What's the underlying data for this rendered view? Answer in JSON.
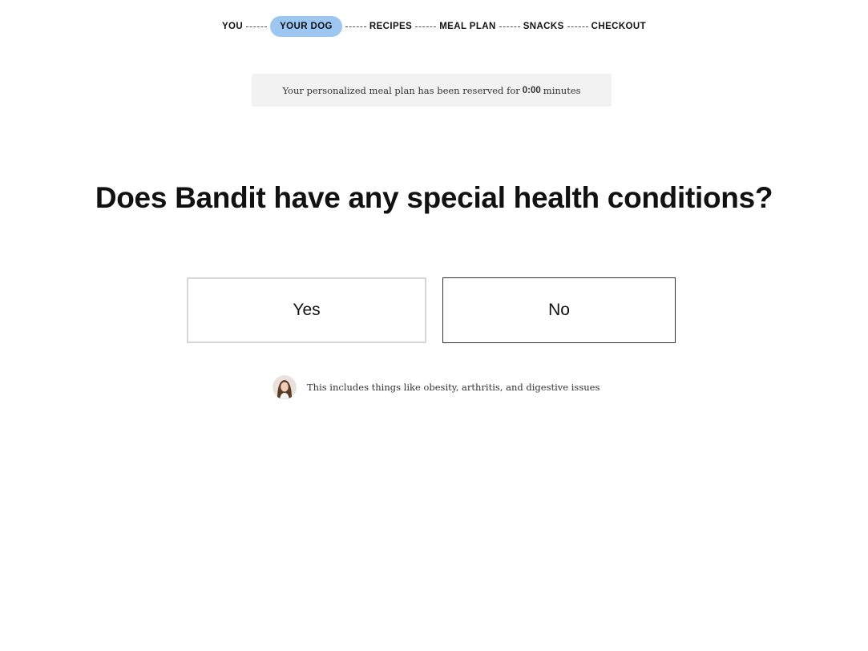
{
  "stepper": {
    "steps": [
      {
        "label": "YOU",
        "active": false
      },
      {
        "label": "YOUR DOG",
        "active": true
      },
      {
        "label": "RECIPES",
        "active": false
      },
      {
        "label": "MEAL PLAN",
        "active": false
      },
      {
        "label": "SNACKS",
        "active": false
      },
      {
        "label": "CHECKOUT",
        "active": false
      }
    ],
    "active_color": "#9cc7f3"
  },
  "timer_banner": {
    "prefix": "Your personalized meal plan has been reserved for",
    "time": "0:00",
    "suffix": "minutes"
  },
  "question": {
    "title": "Does Bandit have any special health conditions?"
  },
  "answers": {
    "yes_label": "Yes",
    "no_label": "No"
  },
  "hint": {
    "text": "This includes things like obesity, arthritis, and digestive issues",
    "avatar_icon": "advisor-avatar"
  }
}
